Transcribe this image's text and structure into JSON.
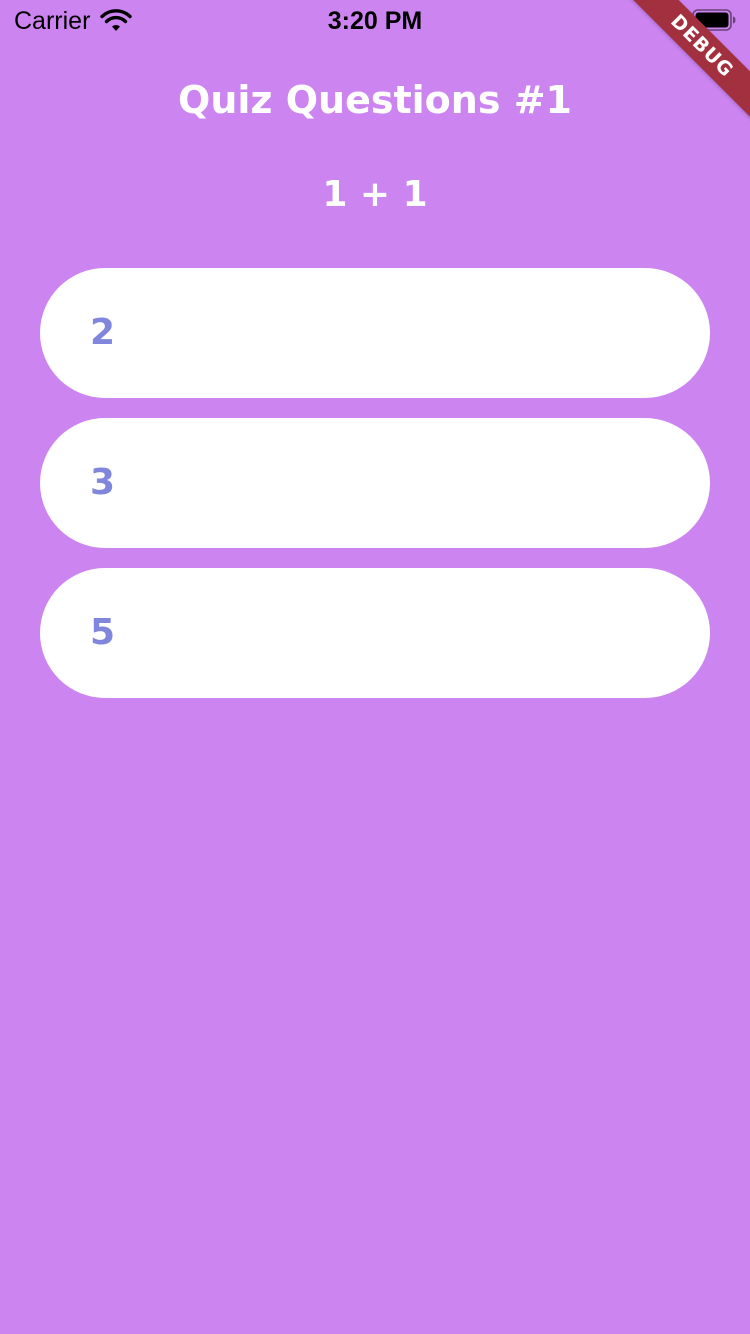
{
  "status_bar": {
    "carrier": "Carrier",
    "time": "3:20 PM"
  },
  "debug_banner": "DEBUG",
  "quiz": {
    "title": "Quiz Questions #1",
    "question": "1 + 1",
    "answers": [
      {
        "label": "2"
      },
      {
        "label": "3"
      },
      {
        "label": "5"
      }
    ]
  },
  "colors": {
    "background": "#cc85f0",
    "answer_text": "#7f86dc",
    "button_bg": "#ffffff",
    "debug_ribbon": "#a3303f"
  },
  "icons": {
    "wifi": "wifi-icon",
    "battery": "battery-icon"
  }
}
